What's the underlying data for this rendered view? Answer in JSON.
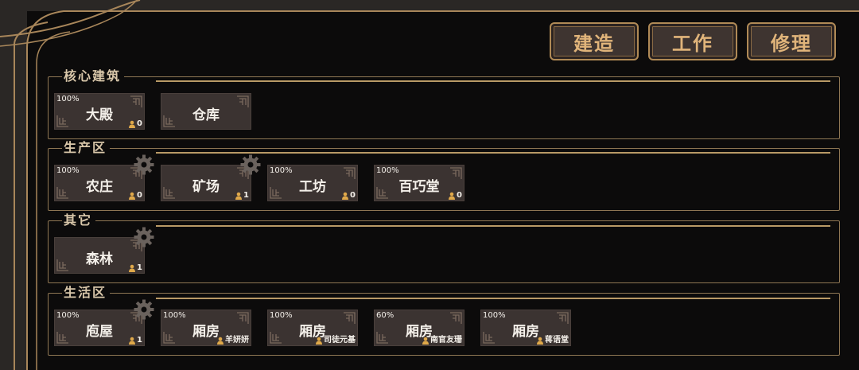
{
  "toolbar": {
    "build": "建造",
    "work": "工作",
    "repair": "修理"
  },
  "sections": [
    {
      "title": "核心建筑",
      "buildings": [
        {
          "name": "大殿",
          "percent": "100%",
          "workers": "0"
        },
        {
          "name": "仓库",
          "percent": "",
          "workers": ""
        }
      ]
    },
    {
      "title": "生产区",
      "buildings": [
        {
          "name": "农庄",
          "percent": "100%",
          "workers": "0"
        },
        {
          "name": "矿场",
          "percent": "",
          "workers": "1"
        },
        {
          "name": "工坊",
          "percent": "100%",
          "workers": "0"
        },
        {
          "name": "百巧堂",
          "percent": "100%",
          "workers": "0"
        }
      ]
    },
    {
      "title": "其它",
      "buildings": [
        {
          "name": "森林",
          "percent": "",
          "workers": "1"
        }
      ]
    },
    {
      "title": "生活区",
      "buildings": [
        {
          "name": "庖屋",
          "percent": "100%",
          "workers": "1"
        },
        {
          "name": "厢房",
          "percent": "100%",
          "workers": "羊妍妍"
        },
        {
          "name": "厢房",
          "percent": "100%",
          "workers": "司徒元基"
        },
        {
          "name": "厢房",
          "percent": "60%",
          "workers": "南官友珊"
        },
        {
          "name": "厢房",
          "percent": "100%",
          "workers": "蒋语堂"
        }
      ]
    }
  ],
  "icons": {
    "gear": "gear-icon",
    "worker": "person-icon",
    "corner": "knot-ornament-icon"
  },
  "colors": {
    "panel_bg": "#0c0b0b",
    "frame_gold": "#b08a56",
    "card_bg": "#3b3331",
    "button_text": "#e0b47a",
    "worker_icon": "#e0a94a"
  }
}
